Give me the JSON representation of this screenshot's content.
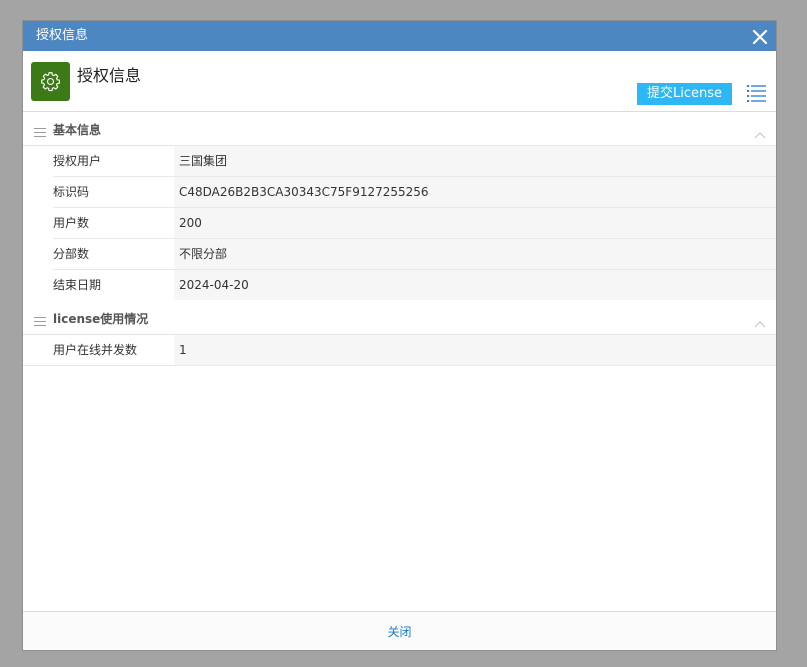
{
  "window": {
    "title": "授权信息",
    "close_icon": "close-icon"
  },
  "header": {
    "title": "授权信息",
    "app_icon": "gear-icon",
    "submit_label": "提交License",
    "menu_icon": "list-menu-icon",
    "colors": {
      "titlebar": "#4d87c2",
      "app_icon_bg": "#3b7a16",
      "button": "#2db7f5"
    }
  },
  "sections": [
    {
      "title": "基本信息",
      "rows": [
        {
          "label": "授权用户",
          "value": "三国集团"
        },
        {
          "label": "标识码",
          "value": "C48DA26B2B3CA30343C75F9127255256"
        },
        {
          "label": "用户数",
          "value": "200"
        },
        {
          "label": "分部数",
          "value": "不限分部"
        },
        {
          "label": "结束日期",
          "value": "2024-04-20"
        }
      ]
    },
    {
      "title": "license使用情况",
      "rows": [
        {
          "label": "用户在线并发数",
          "value": "1"
        }
      ]
    }
  ],
  "footer": {
    "close_label": "关闭",
    "link_color": "#1f7ac7"
  }
}
